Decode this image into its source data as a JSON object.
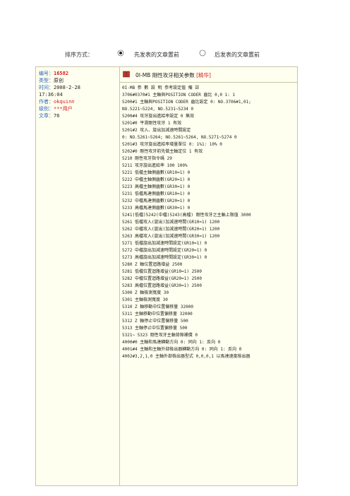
{
  "sort": {
    "label": "排序方式：",
    "option1": "先发表的文章置前",
    "option2": "后发表的文章置前",
    "selected": 1
  },
  "author_panel": {
    "number_label": "编号：",
    "number_value": "16582",
    "type_label": "类型：",
    "type_value": "原创",
    "time_label": "时间：",
    "time_value1": "2008-2-28",
    "time_value2": "17:36:04",
    "author_label": "作者：",
    "author_value": "okquinn",
    "level_label": "级别：",
    "level_value": "***用户",
    "articles_label": "文章：",
    "articles_value": "76"
  },
  "post": {
    "title": "0I-MB 剛性攻牙相关参数",
    "tag": "[精华]",
    "icon": "book-icon",
    "lines": [
      "0I-MB 参  數   設   明  参考設定值  備   註",
      "3706#0370#1 主軸與POSITION  CODER 齒比 0,0    1: 1",
      "5200#1 主軸與POSITION  CODER 齒比設定 0: NO.3706#1,01;",
      "NO.5221~5224,  NO.5231~5234 0",
      "5200#4 攻牙旋出進給率設定 0 無效",
      "5201#0 平滑剛性攻牙 1 有效",
      "5201#2 攻入、旋出加減速時間設定",
      "0:   NO.5261~5264;   NO.5261~5264,  NO.5271~5274 0",
      "5201#3 攻牙旋出進給率增量單位 0: 1%1: 10% 0",
      "5202#0 剛性攻牙前先做主軸定位 1 有效",
      "5210 剛性攻牙指令碼 29",
      "5211 攻牙旋出進給率 100 100%",
      "5221 低檔主軸側齒數(GR10=1) 0",
      "5222 中檔主軸側齒數(GR20=1) 0",
      "5223 高檔主軸側齒數(GR30=1) 0",
      "5231 低檔馬達側齒數(GR10=1) 0",
      "5232 中檔馬達側齒數(GR20=1) 0",
      "5233 高檔馬達側齒數(GR30=1) 0",
      "5241(低檔)5242(中檔)5243(高檔) 剛性攻牙之主軸上限值 3000",
      "5261 低檔攻入(旋出)加減速時間(GR10=1) 1200",
      "5262 中檔攻入(旋出)加減速時間(GR20=1) 1200",
      "5263 高檔攻入(旋出)加減速時間(GR30=1) 1200",
      "5271 低檔旋出加減速時間設定(GR10=1) 0",
      "5272 中檔旋出加減速時間設定(GR20=1) 0",
      "5273 高檔旋出加減速時間設定(GR30=1) 0",
      "5280 Z  軸位置迴路增益 2500",
      "5281 低檔位置迴路增益(GR10=1) 2500",
      "5282 中檔位置迴路增益(GR20=1) 2500",
      "5283 高檔位置迴路增益(GR30=1) 2500",
      "5300 Z  軸檢測寬度 30",
      "5301 主軸檢測寬度 30",
      "5310 Z  軸移動中位置偏移量 32000",
      "5311 主軸移動中位置偏移量 32000",
      "5312 Z  軸停止中位置偏移量 500",
      "5313 主軸停止中位置偏移量 500",
      "5321~  5323 剛性攻牙主軸背隙補償 0",
      "4000#0 主軸和馬達轉動方向 0: 同向 1: 反向 0",
      "4001#4 主軸和主軸外部檢出器轉動方向 0: 同向 1: 反向 0",
      "4002#3,2,1,0 主軸外部檢出器型式 0,0,0,1 以馬達速度檢出器"
    ]
  }
}
